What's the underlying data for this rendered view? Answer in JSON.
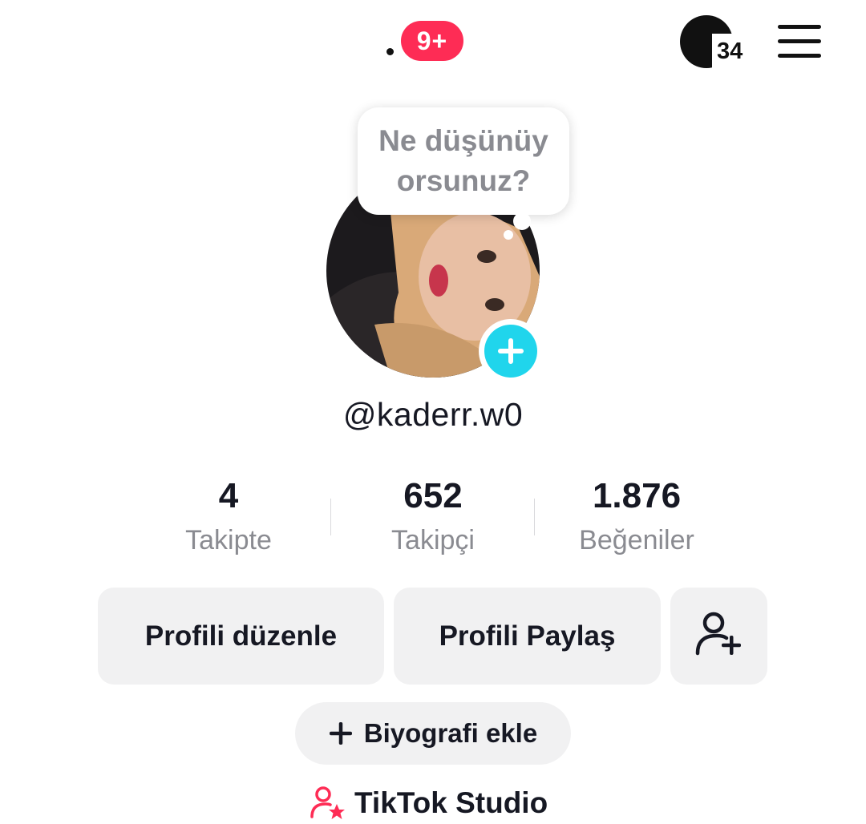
{
  "topbar": {
    "notification_badge": "9+",
    "moon_count": "34"
  },
  "profile": {
    "note_text": "Ne düşünüy orsunuz?",
    "username": "@kaderr.w0"
  },
  "stats": [
    {
      "value": "4",
      "label": "Takipte"
    },
    {
      "value": "652",
      "label": "Takipçi"
    },
    {
      "value": "1.876",
      "label": "Beğeniler"
    }
  ],
  "actions": {
    "edit_profile": "Profili düzenle",
    "share_profile": "Profili Paylaş",
    "add_bio": "Biyografi ekle",
    "studio": "TikTok Studio"
  },
  "colors": {
    "accent_red": "#fe2c55",
    "accent_cyan": "#20d5ec",
    "button_bg": "#f1f1f2",
    "secondary_text": "#8a8b91"
  },
  "icons": {
    "menu": "hamburger-menu-icon",
    "moon": "moon-icon",
    "add_user": "add-friend-icon",
    "studio": "creator-star-icon",
    "add_avatar": "plus-icon"
  }
}
